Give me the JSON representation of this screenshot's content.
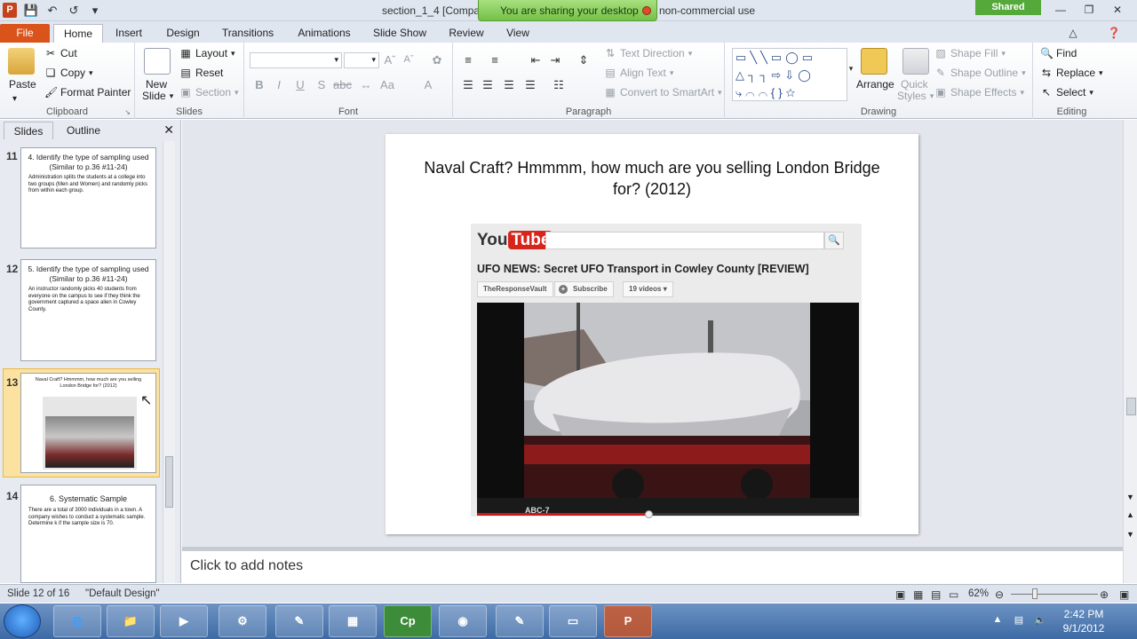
{
  "window": {
    "title_left": "section_1_4 [Compa",
    "title_right": "non-commercial use",
    "share_banner": "You are sharing your desktop",
    "shared_label": "Shared",
    "app_icon_letter": "P"
  },
  "tabs": [
    "File",
    "Home",
    "Insert",
    "Design",
    "Transitions",
    "Animations",
    "Slide Show",
    "Review",
    "View"
  ],
  "ribbon": {
    "clipboard": {
      "label": "Clipboard",
      "paste": "Paste",
      "cut": "Cut",
      "copy": "Copy",
      "format_painter": "Format Painter"
    },
    "slides": {
      "label": "Slides",
      "new_slide_1": "New",
      "new_slide_2": "Slide",
      "layout": "Layout",
      "reset": "Reset",
      "section": "Section"
    },
    "font": {
      "label": "Font"
    },
    "paragraph": {
      "label": "Paragraph",
      "text_direction": "Text Direction",
      "align_text": "Align Text",
      "convert_smartart": "Convert to SmartArt"
    },
    "drawing": {
      "label": "Drawing",
      "arrange": "Arrange",
      "quick_styles_1": "Quick",
      "quick_styles_2": "Styles",
      "shape_fill": "Shape Fill",
      "shape_outline": "Shape Outline",
      "shape_effects": "Shape Effects"
    },
    "editing": {
      "label": "Editing",
      "find": "Find",
      "replace": "Replace",
      "select": "Select"
    }
  },
  "panel": {
    "tab_slides": "Slides",
    "tab_outline": "Outline",
    "thumbs": [
      {
        "num": "11",
        "title": "4.  Identify the type of sampling used (Similar to p.36 #11-24)",
        "body": "Administration splits the students at a college into two groups (Men and Women) and randomly picks from within each group."
      },
      {
        "num": "12",
        "title": "5.  Identify the type of sampling used (Similar to p.36 #11-24)",
        "body": "An instructor randomly picks 40 students from everyone on the campus to see if they think the government captured a space alien in Cowley County."
      },
      {
        "num": "13",
        "title": "Naval Craft? Hmmmm, how much are you selling London Bridge for? (2012)",
        "body": ""
      },
      {
        "num": "14",
        "title": "6.  Systematic Sample",
        "body": "There are a total of 3000 individuals in a town.  A company wishes to conduct a systematic sample.  Determine k if the sample size is 70."
      }
    ]
  },
  "slide": {
    "title": "Naval Craft? Hmmmm, how much are you selling London Bridge for? (2012)",
    "youtube": {
      "logo_you": "You",
      "logo_tube": "Tube",
      "video_title": "UFO NEWS: Secret UFO Transport in Cowley County [REVIEW]",
      "channel": "TheResponseVault",
      "subscribe": "Subscribe",
      "videos": "19 videos",
      "watermark": "ABC-7",
      "progress": 0.45
    }
  },
  "notes": {
    "placeholder": "Click to add notes"
  },
  "status": {
    "slide_info": "Slide 12 of 16",
    "theme": "\"Default Design\"",
    "zoom": "62%"
  },
  "taskbar": {
    "time": "2:42 PM",
    "date": "9/1/2012"
  },
  "colors": {
    "file_tab": "#d9531a",
    "shared_badge": "#54a93a",
    "youtube_red": "#d6261c",
    "selected_thumb": "#fbe2a0"
  }
}
